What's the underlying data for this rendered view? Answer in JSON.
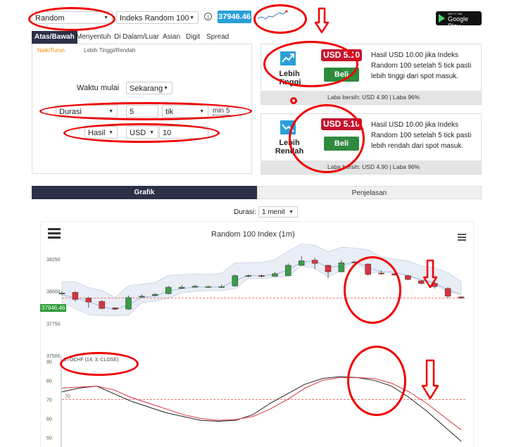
{
  "top": {
    "market_select": "Random",
    "symbol_select": "Indeks Random 100",
    "info_icon": "info-icon",
    "spot_price": "37946.46",
    "google_play": {
      "small": "GET IT ON",
      "big": "Google Play"
    }
  },
  "trade_tabs": [
    "Atas/Bawah",
    "Menyentuh",
    "Di Dalam/Luar",
    "Asian",
    "Digit",
    "Spread"
  ],
  "sub_tabs": [
    "Naik/Turun",
    "Lebih Tinggi/Rendah"
  ],
  "form": {
    "start_label": "Waktu mulai",
    "start_value": "Sekarang",
    "duration_type": "Durasi",
    "duration_value": "5",
    "duration_unit": "tik",
    "duration_min": "min 5",
    "payout_type": "Hasil",
    "currency": "USD",
    "amount": "10"
  },
  "contracts": [
    {
      "name_line1": "Lebih",
      "name_line2": "Tinggi",
      "price": "USD 5.10",
      "buy": "Beli",
      "desc": "Hasil USD 10.00 jika Indeks Random 100 setelah 5 tick pasti lebih tinggi dari spot masuk.",
      "footer": "Laba bersih: USD 4.90 | Laba 96%"
    },
    {
      "name_line1": "Lebih",
      "name_line2": "Rendah",
      "price": "USD 5.10",
      "buy": "Beli",
      "desc": "Hasil USD 10.00 jika Indeks Random 100 setelah 5 tick pasti lebih rendah dari spot masuk.",
      "footer": "Laba bersih: USD 4.90 | Laba 96%"
    }
  ],
  "chart_tabs": [
    "Grafik",
    "Penjelasan"
  ],
  "chart_controls": {
    "duration_label": "Durasi:",
    "duration_value": "1 menit"
  },
  "chart_data": {
    "type": "candlestick",
    "title": "Random 100 Index (1m)",
    "price_panel": {
      "y_ticks": [
        38250,
        38000,
        37750,
        37500
      ],
      "last_price": "37946.46",
      "ylim": [
        37500,
        38380
      ],
      "candles": [
        {
          "o": 37985,
          "c": 37985,
          "h": 38000,
          "l": 37970
        },
        {
          "o": 37990,
          "c": 37935,
          "h": 38000,
          "l": 37920
        },
        {
          "o": 37945,
          "c": 37915,
          "h": 37955,
          "l": 37870
        },
        {
          "o": 37920,
          "c": 37865,
          "h": 37930,
          "l": 37860
        },
        {
          "o": 37870,
          "c": 37860,
          "h": 37875,
          "l": 37855
        },
        {
          "o": 37860,
          "c": 37950,
          "h": 37965,
          "l": 37855
        },
        {
          "o": 37955,
          "c": 37960,
          "h": 37975,
          "l": 37948
        },
        {
          "o": 37965,
          "c": 37975,
          "h": 37985,
          "l": 37958
        },
        {
          "o": 37980,
          "c": 38030,
          "h": 38040,
          "l": 37975
        },
        {
          "o": 38020,
          "c": 38030,
          "h": 38045,
          "l": 38015
        },
        {
          "o": 38030,
          "c": 38038,
          "h": 38048,
          "l": 38022
        },
        {
          "o": 38030,
          "c": 38035,
          "h": 38042,
          "l": 38025
        },
        {
          "o": 38030,
          "c": 38035,
          "h": 38050,
          "l": 38022
        },
        {
          "o": 38040,
          "c": 38120,
          "h": 38130,
          "l": 38035
        },
        {
          "o": 38120,
          "c": 38120,
          "h": 38130,
          "l": 38108
        },
        {
          "o": 38120,
          "c": 38115,
          "h": 38130,
          "l": 38105
        },
        {
          "o": 38115,
          "c": 38135,
          "h": 38150,
          "l": 38110
        },
        {
          "o": 38120,
          "c": 38200,
          "h": 38215,
          "l": 38115
        },
        {
          "o": 38200,
          "c": 38235,
          "h": 38270,
          "l": 38195
        },
        {
          "o": 38240,
          "c": 38215,
          "h": 38258,
          "l": 38170
        },
        {
          "o": 38200,
          "c": 38150,
          "h": 38205,
          "l": 38100
        },
        {
          "o": 38150,
          "c": 38220,
          "h": 38240,
          "l": 38145
        },
        {
          "o": 38225,
          "c": 38220,
          "h": 38230,
          "l": 38215
        },
        {
          "o": 38210,
          "c": 38130,
          "h": 38215,
          "l": 38120
        },
        {
          "o": 38140,
          "c": 38135,
          "h": 38160,
          "l": 38125
        },
        {
          "o": 38135,
          "c": 38125,
          "h": 38140,
          "l": 38120
        },
        {
          "o": 38120,
          "c": 38090,
          "h": 38125,
          "l": 38085
        },
        {
          "o": 38080,
          "c": 38060,
          "h": 38085,
          "l": 38050
        },
        {
          "o": 38060,
          "c": 38035,
          "h": 38070,
          "l": 38020
        },
        {
          "o": 38020,
          "c": 37960,
          "h": 38030,
          "l": 37945
        },
        {
          "o": 37955,
          "c": 37946,
          "h": 37960,
          "l": 37940
        }
      ]
    },
    "stoch_panel": {
      "label": "STOCHF (14, 3, CLOSE)",
      "y_ticks": [
        90,
        80,
        70,
        60,
        50
      ],
      "level": 70,
      "ylim": [
        45,
        92
      ],
      "k": [
        74,
        76,
        77,
        73,
        69,
        66,
        63,
        61,
        59,
        58.5,
        59,
        62,
        68,
        73,
        78,
        81,
        82,
        81.5,
        80,
        77,
        71,
        64,
        56,
        48
      ],
      "d": [
        76,
        76.5,
        77,
        75,
        71,
        68,
        65,
        62,
        60,
        59,
        59.5,
        61,
        65,
        70,
        76,
        80,
        81.5,
        81.5,
        81,
        78.5,
        74,
        68,
        61,
        54
      ]
    }
  },
  "annotations": {
    "arrow": "down-arrow-icon",
    "circle": "red-circle-markup"
  }
}
